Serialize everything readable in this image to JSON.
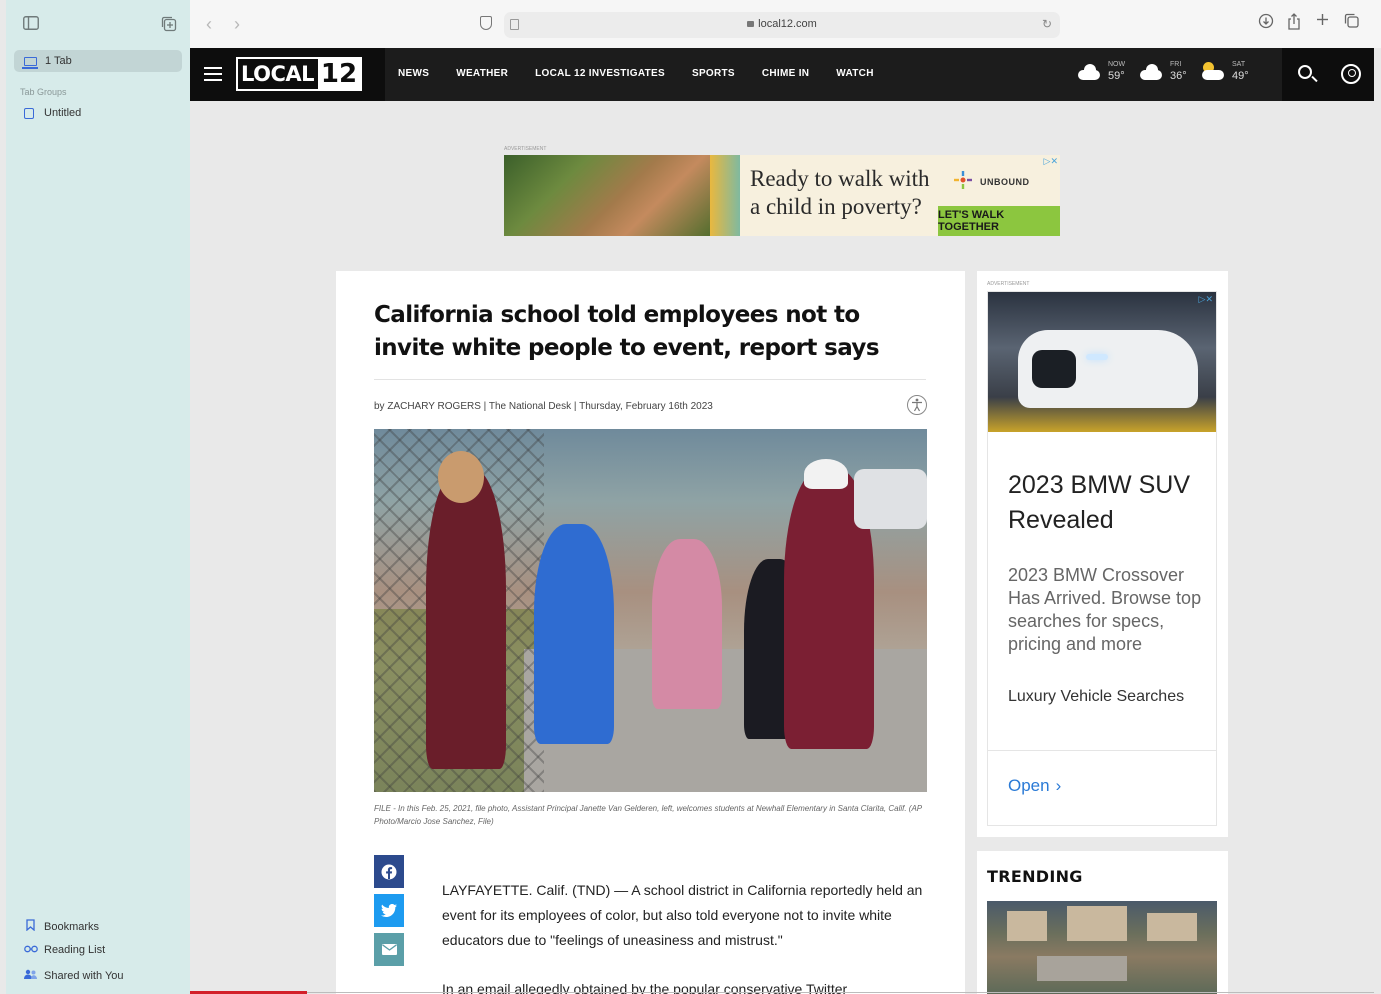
{
  "sidebar": {
    "tab_count_label": "1 Tab",
    "tab_groups_label": "Tab Groups",
    "group_name": "Untitled",
    "bottom": [
      {
        "label": "Bookmarks",
        "icon": "bookmark-icon"
      },
      {
        "label": "Reading List",
        "icon": "reading-list-icon"
      },
      {
        "label": "Shared with You",
        "icon": "shared-with-you-icon"
      }
    ]
  },
  "browser": {
    "url": "local12.com"
  },
  "site": {
    "logo_text": "LOCAL",
    "logo_number": "12",
    "nav": [
      "NEWS",
      "WEATHER",
      "LOCAL 12 INVESTIGATES",
      "SPORTS",
      "CHIME IN",
      "WATCH"
    ],
    "weather": [
      {
        "label": "NOW",
        "temp": "59°",
        "icon": "cloud-icon"
      },
      {
        "label": "FRI",
        "temp": "36°",
        "icon": "snow-cloud-icon"
      },
      {
        "label": "SAT",
        "temp": "49°",
        "icon": "partly-sunny-icon"
      }
    ]
  },
  "top_ad": {
    "label": "ADVERTISEMENT",
    "headline_1": "Ready to walk with",
    "headline_2": "a child in poverty?",
    "brand": "UNBOUND",
    "cta": "LET'S WALK TOGETHER",
    "adchoices": "▷✕"
  },
  "article": {
    "title": "California school told employees not to invite white people to event, report says",
    "byline": "by ZACHARY ROGERS | The National Desk   |   Thursday, February 16th 2023",
    "caption": "FILE - In this Feb. 25, 2021, file photo, Assistant Principal Janette Van Gelderen, left, welcomes students at Newhall Elementary in Santa Clarita, Calif. (AP Photo/Marcio Jose Sanchez, File)",
    "paragraph_1": "LAYFAYETTE. Calif. (TND) — A school district in California reportedly held an event for its employees of color, but also told everyone not to invite white educators due to \"feelings of uneasiness and mistrust.\"",
    "paragraph_2": "In an email allegedly obtained by the popular conservative Twitter"
  },
  "rail_ad": {
    "label": "ADVERTISEMENT",
    "adchoices": "▷✕",
    "title": "2023 BMW SUV Revealed",
    "description": "2023 BMW Crossover Has Arrived. Browse top searches for specs, pricing and more",
    "sponsor": "Luxury Vehicle Searches",
    "cta": "Open",
    "cta_chevron": "›"
  },
  "trending": {
    "heading": "TRENDING"
  }
}
